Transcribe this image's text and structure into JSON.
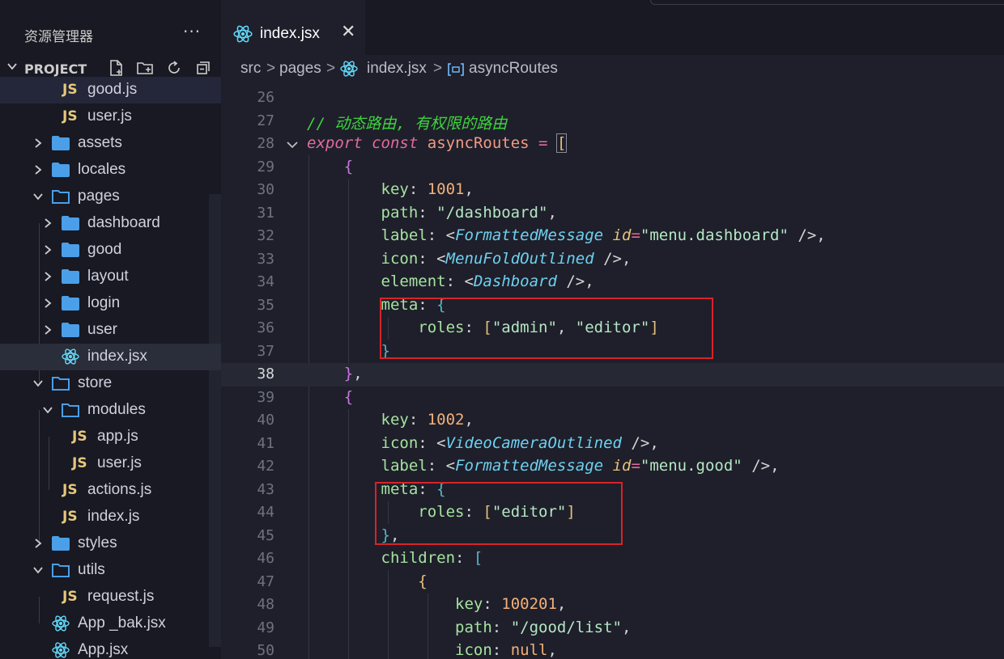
{
  "sidebar": {
    "title": "资源管理器",
    "more": "···",
    "project_label": "PROJECT",
    "items": [
      {
        "label": "good.js",
        "type": "js"
      },
      {
        "label": "user.js",
        "type": "js"
      },
      {
        "label": "assets",
        "type": "folder"
      },
      {
        "label": "locales",
        "type": "folder"
      },
      {
        "label": "pages",
        "type": "folder"
      },
      {
        "label": "dashboard",
        "type": "folder"
      },
      {
        "label": "good",
        "type": "folder"
      },
      {
        "label": "layout",
        "type": "folder"
      },
      {
        "label": "login",
        "type": "folder"
      },
      {
        "label": "user",
        "type": "folder"
      },
      {
        "label": "index.jsx",
        "type": "react"
      },
      {
        "label": "store",
        "type": "folder"
      },
      {
        "label": "modules",
        "type": "folder"
      },
      {
        "label": "app.js",
        "type": "js"
      },
      {
        "label": "user.js",
        "type": "js"
      },
      {
        "label": "actions.js",
        "type": "js"
      },
      {
        "label": "index.js",
        "type": "js"
      },
      {
        "label": "styles",
        "type": "folder"
      },
      {
        "label": "utils",
        "type": "folder"
      },
      {
        "label": "request.js",
        "type": "js"
      },
      {
        "label": "App _bak.jsx",
        "type": "react"
      },
      {
        "label": "App.jsx",
        "type": "react"
      }
    ],
    "js_badge": "JS"
  },
  "tab": {
    "label": "index.jsx",
    "close": "✕"
  },
  "breadcrumb": {
    "src": "src",
    "pages": "pages",
    "file": "index.jsx",
    "symbol": "asyncRoutes",
    "sep": ">"
  },
  "code": {
    "line_numbers": [
      "26",
      "27",
      "28",
      "29",
      "30",
      "31",
      "32",
      "33",
      "34",
      "35",
      "36",
      "37",
      "38",
      "39",
      "40",
      "41",
      "42",
      "43",
      "44",
      "45",
      "46",
      "47",
      "48",
      "49",
      "50"
    ],
    "current_line": "38"
  },
  "colors": {
    "highlight_box": "#d8232a",
    "comment": "#3fd33f",
    "keyword": "#e06c9b"
  }
}
